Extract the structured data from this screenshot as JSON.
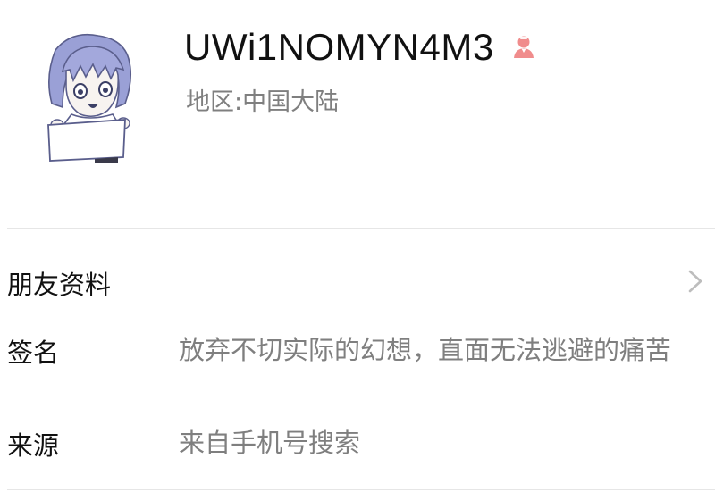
{
  "profile": {
    "nickname": "UWi1NOMYN4M3",
    "gender_icon": "female-icon",
    "gender_color": "#f08c8c",
    "region_label": "地区:",
    "region_value": "中国大陆",
    "avatar_icon": "anime-avatar"
  },
  "friend_info": {
    "label": "朋友资料",
    "chevron_icon": "chevron-right-icon"
  },
  "details": {
    "signature_label": "签名",
    "signature_value": "放弃不切实际的幻想，直面无法逃避的痛苦",
    "source_label": "来源",
    "source_value": "来自手机号搜索"
  }
}
